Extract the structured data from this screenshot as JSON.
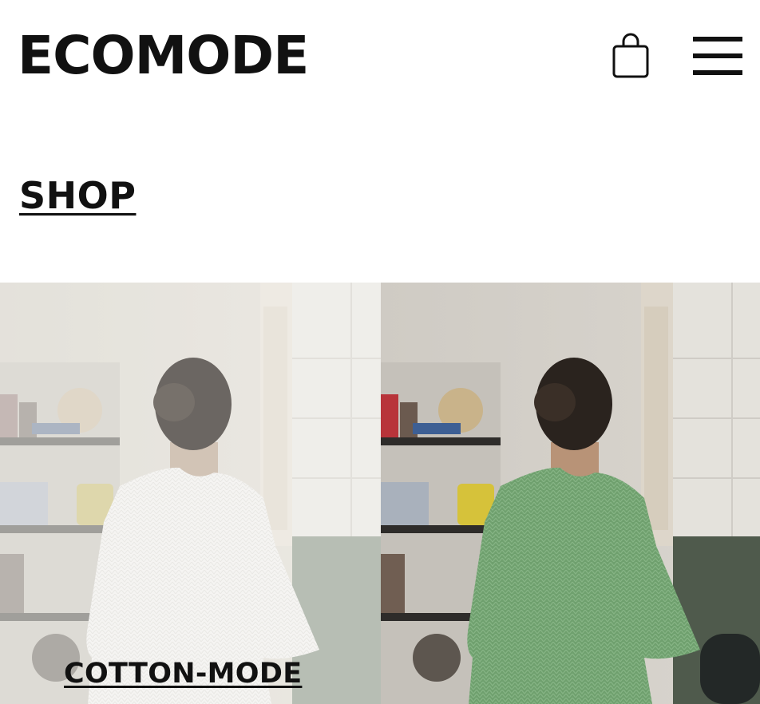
{
  "header": {
    "logo_text": "ECOMODE",
    "cart_icon": "shopping-bag-icon",
    "menu_icon": "hamburger-menu-icon"
  },
  "section": {
    "title": "SHOP"
  },
  "products": [
    {
      "name": "COTTON-MODE",
      "shirt_color": "#f2f2ef"
    },
    {
      "name": "",
      "shirt_color": "#6fa06e"
    }
  ],
  "colors": {
    "text": "#111111",
    "background": "#ffffff"
  }
}
